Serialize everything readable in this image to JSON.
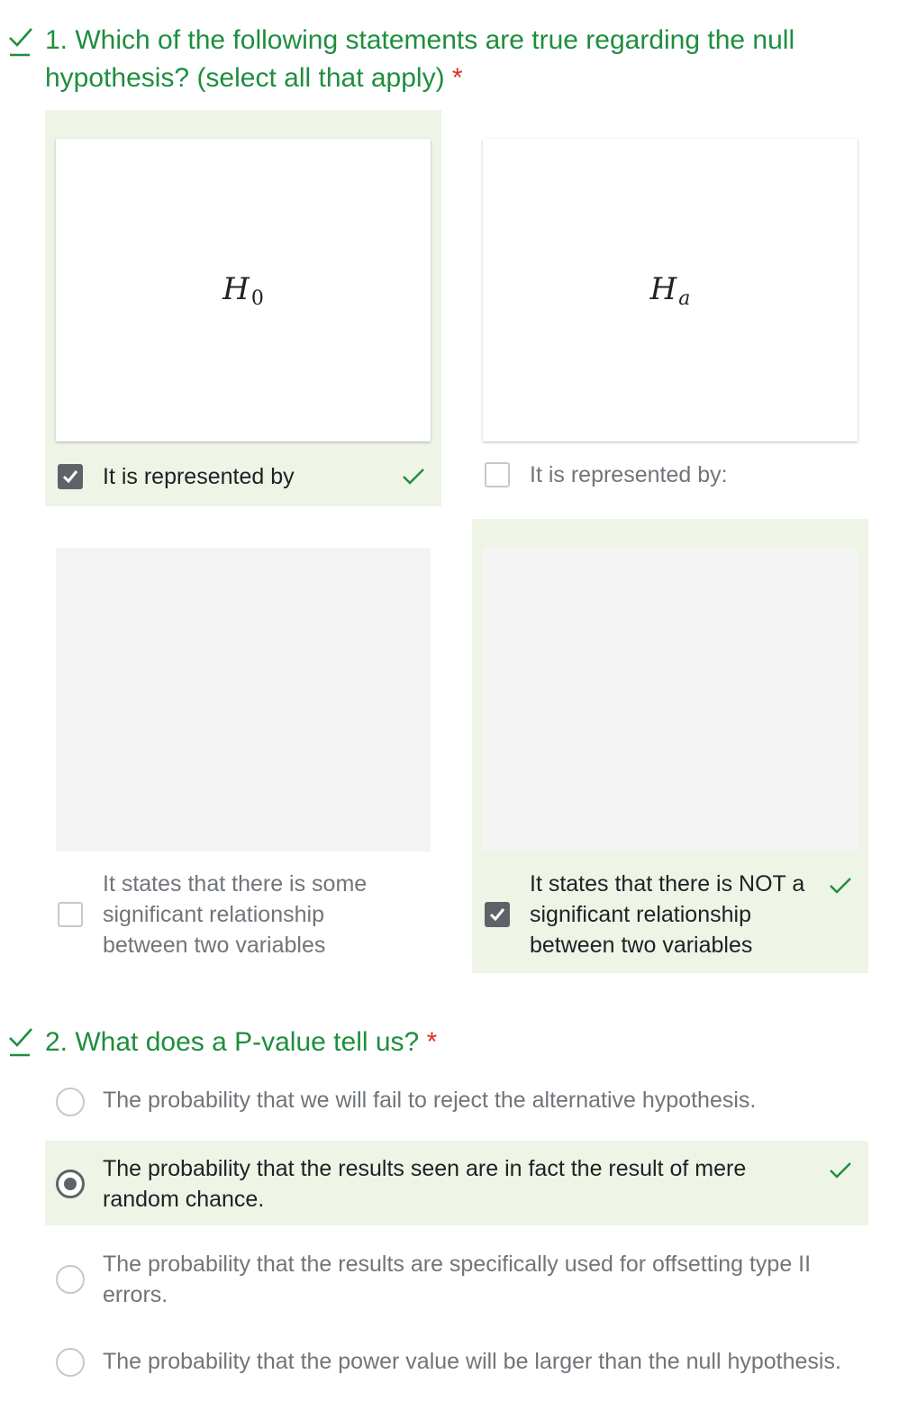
{
  "question1": {
    "title": "1. Which of the following statements are true regarding the null hypothesis? (select all that apply)",
    "required_mark": "*",
    "options": [
      {
        "label": "It is represented by",
        "math_main": "H",
        "math_sub": "0",
        "checked": true,
        "correct": true
      },
      {
        "label": "It is represented by:",
        "math_main": "H",
        "math_sub": "a",
        "checked": false
      },
      {
        "label": "It states that there is some significant relationship between two variables",
        "checked": false
      },
      {
        "label": "It states that there is NOT a significant relationship between two variables",
        "checked": true,
        "correct": true
      }
    ]
  },
  "question2": {
    "title": "2. What does a P-value tell us?",
    "required_mark": "*",
    "options": [
      {
        "label": "The probability that we will fail to reject the alternative hypothesis.",
        "selected": false
      },
      {
        "label": "The probability that the results seen are in fact the result of mere random chance.",
        "selected": true,
        "correct": true
      },
      {
        "label": "The probability that the results are specifically used for offsetting type II errors.",
        "selected": false
      },
      {
        "label": "The probability that the power value will be larger than the null hypothesis.",
        "selected": false
      }
    ]
  },
  "colors": {
    "accent_green": "#1e8e3e",
    "selected_bg": "#eef5e7",
    "control_gray": "#5f6368",
    "required_red": "#d93025"
  }
}
